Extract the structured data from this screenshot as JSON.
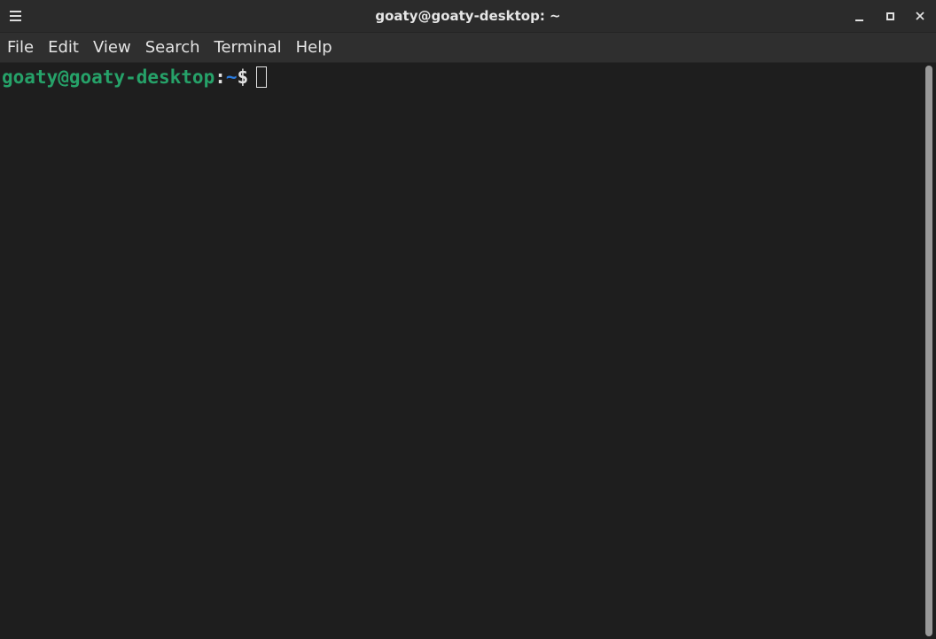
{
  "window": {
    "title": "goaty@goaty-desktop: ~"
  },
  "menu": {
    "items": [
      "File",
      "Edit",
      "View",
      "Search",
      "Terminal",
      "Help"
    ]
  },
  "terminal": {
    "prompt_user_host": "goaty@goaty-desktop",
    "prompt_colon": ":",
    "prompt_path": "~",
    "prompt_symbol": "$",
    "input": ""
  },
  "icons": {
    "menu": "hamburger-menu-icon",
    "minimize": "minimize-icon",
    "maximize": "maximize-icon",
    "close": "close-icon"
  },
  "colors": {
    "background": "#1e1e1e",
    "titlebar": "#2b2b2b",
    "menubar": "#2f2f2f",
    "prompt_user_host": "#26a269",
    "prompt_path": "#2a7bde",
    "text": "#e4e4e4"
  }
}
